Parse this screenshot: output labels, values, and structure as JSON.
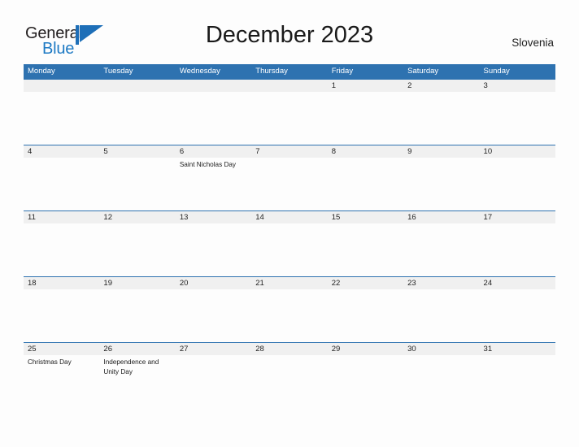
{
  "brand": {
    "name_part1": "General",
    "name_part2": "Blue",
    "mark": "flag-triangle-icon",
    "accent_color": "#1e7ac4"
  },
  "header": {
    "title": "December 2023",
    "region": "Slovenia"
  },
  "colors": {
    "header_blue": "#2e72b0",
    "date_band_gray": "#f0f0f0",
    "page_background": "#fdfdfd",
    "text": "#1a1a1a"
  },
  "calendar": {
    "weekdays": [
      "Monday",
      "Tuesday",
      "Wednesday",
      "Thursday",
      "Friday",
      "Saturday",
      "Sunday"
    ],
    "weeks": [
      [
        {
          "day": "",
          "event": ""
        },
        {
          "day": "",
          "event": ""
        },
        {
          "day": "",
          "event": ""
        },
        {
          "day": "",
          "event": ""
        },
        {
          "day": "1",
          "event": ""
        },
        {
          "day": "2",
          "event": ""
        },
        {
          "day": "3",
          "event": ""
        }
      ],
      [
        {
          "day": "4",
          "event": ""
        },
        {
          "day": "5",
          "event": ""
        },
        {
          "day": "6",
          "event": "Saint Nicholas Day"
        },
        {
          "day": "7",
          "event": ""
        },
        {
          "day": "8",
          "event": ""
        },
        {
          "day": "9",
          "event": ""
        },
        {
          "day": "10",
          "event": ""
        }
      ],
      [
        {
          "day": "11",
          "event": ""
        },
        {
          "day": "12",
          "event": ""
        },
        {
          "day": "13",
          "event": ""
        },
        {
          "day": "14",
          "event": ""
        },
        {
          "day": "15",
          "event": ""
        },
        {
          "day": "16",
          "event": ""
        },
        {
          "day": "17",
          "event": ""
        }
      ],
      [
        {
          "day": "18",
          "event": ""
        },
        {
          "day": "19",
          "event": ""
        },
        {
          "day": "20",
          "event": ""
        },
        {
          "day": "21",
          "event": ""
        },
        {
          "day": "22",
          "event": ""
        },
        {
          "day": "23",
          "event": ""
        },
        {
          "day": "24",
          "event": ""
        }
      ],
      [
        {
          "day": "25",
          "event": "Christmas Day"
        },
        {
          "day": "26",
          "event": "Independence and Unity Day"
        },
        {
          "day": "27",
          "event": ""
        },
        {
          "day": "28",
          "event": ""
        },
        {
          "day": "29",
          "event": ""
        },
        {
          "day": "30",
          "event": ""
        },
        {
          "day": "31",
          "event": ""
        }
      ]
    ]
  }
}
